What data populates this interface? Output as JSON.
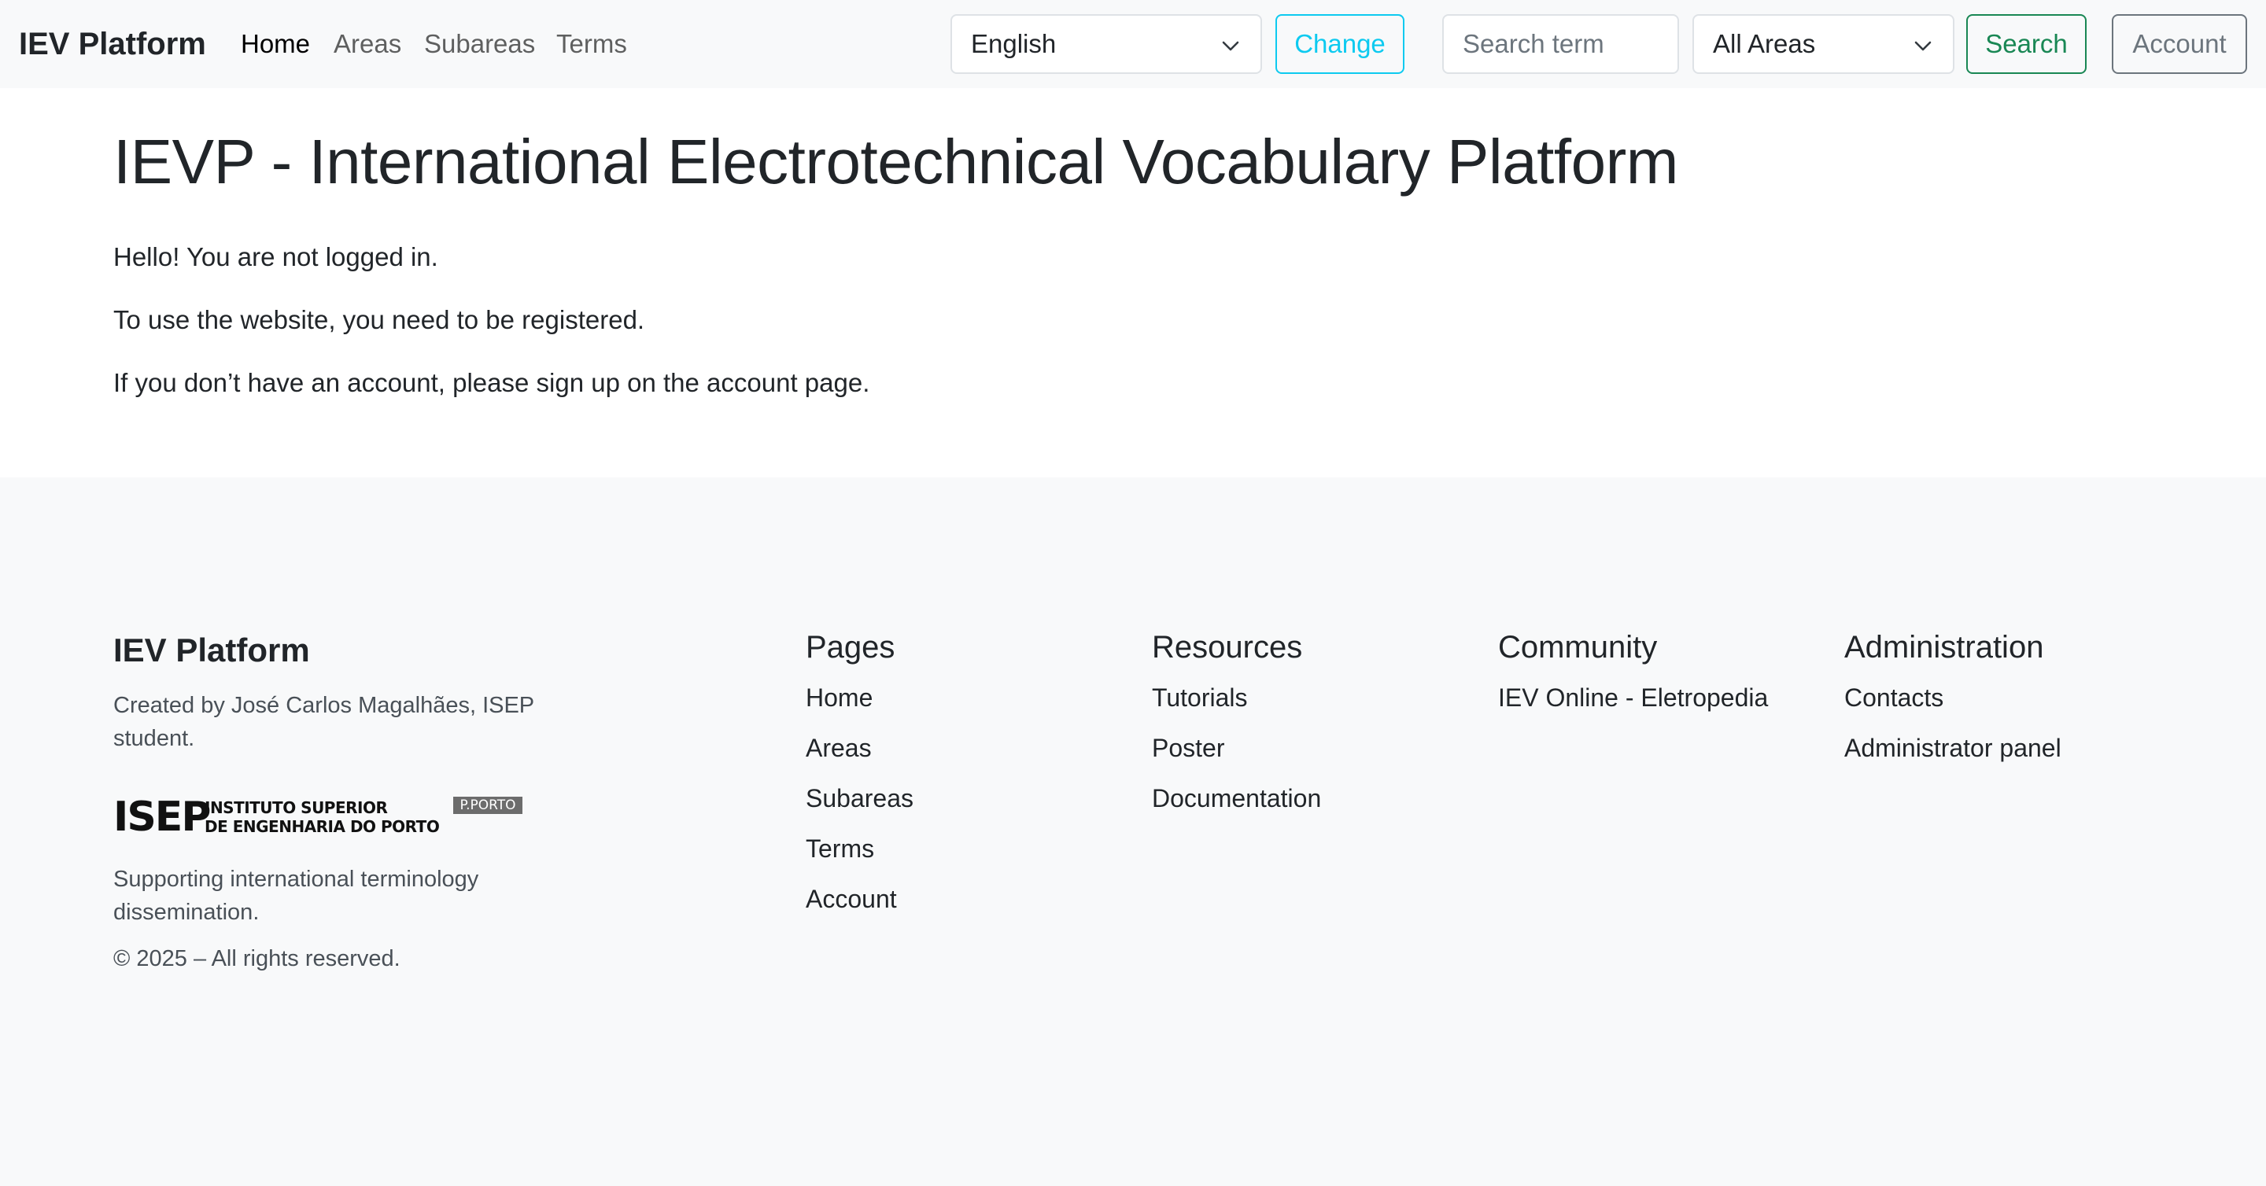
{
  "navbar": {
    "brand": "IEV Platform",
    "links": [
      "Home",
      "Areas",
      "Subareas",
      "Terms"
    ],
    "language_select": "English",
    "change_button": "Change",
    "search_placeholder": "Search term",
    "area_select": "All Areas",
    "search_button": "Search",
    "account_button": "Account"
  },
  "main": {
    "title": "IEVP - International Electrotechnical Vocabulary Platform",
    "paragraphs": [
      "Hello! You are not logged in.",
      "To use the website, you need to be registered.",
      "If you don’t have an account, please sign up on the account page."
    ]
  },
  "footer": {
    "brand": "IEV Platform",
    "credit": "Created by José Carlos Magalhães, ISEP student.",
    "logo": {
      "mark": "ISEP",
      "line1": "INSTITUTO SUPERIOR",
      "line2": "DE ENGENHARIA DO PORTO",
      "badge": "P.PORTO"
    },
    "tagline": "Supporting international terminology dissemination.",
    "copyright": "© 2025 – All rights reserved.",
    "columns": [
      {
        "title": "Pages",
        "links": [
          "Home",
          "Areas",
          "Subareas",
          "Terms",
          "Account"
        ]
      },
      {
        "title": "Resources",
        "links": [
          "Tutorials",
          "Poster",
          "Documentation"
        ]
      },
      {
        "title": "Community",
        "links": [
          "IEV Online - Eletropedia"
        ]
      },
      {
        "title": "Administration",
        "links": [
          "Contacts",
          "Administrator panel"
        ]
      }
    ]
  },
  "colors": {
    "navbar_bg": "#f8f9fa",
    "info": "#0dcaf0",
    "success": "#198754",
    "secondary": "#6c757d"
  },
  "icons": [
    "chevron-down-icon"
  ]
}
